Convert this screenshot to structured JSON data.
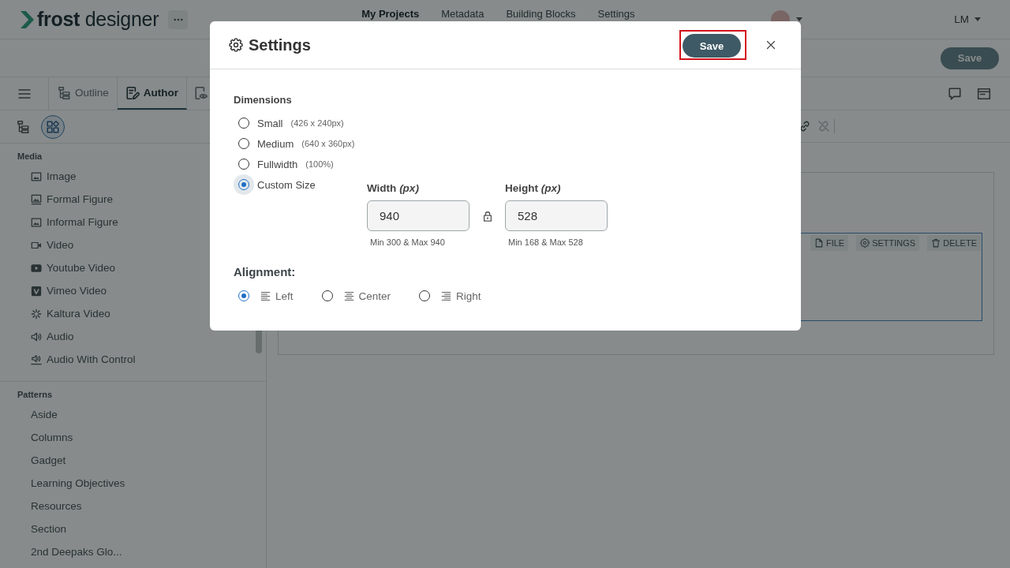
{
  "app_bar": {
    "logo": "**frost** designer",
    "nav": [
      {
        "label": "My Projects",
        "selected": true
      },
      {
        "label": "Metadata",
        "selected": false
      },
      {
        "label": "Building Blocks",
        "selected": false
      },
      {
        "label": "Settings",
        "selected": false
      }
    ],
    "user": "LM"
  },
  "action_bar": {
    "save_button": "Save"
  },
  "view_tabs": [
    {
      "label": "Outline",
      "selected": false
    },
    {
      "label": "Author",
      "selected": true
    },
    {
      "selected": false
    }
  ],
  "panel_views": [
    {
      "selected": false
    },
    {
      "selected": true
    }
  ],
  "sidebar": {
    "sections": [
      {
        "title": "Media",
        "kind": "icons",
        "items": [
          "Image",
          "Formal Figure",
          "Informal Figure",
          "Video",
          "Youtube Video",
          "Vimeo Video",
          "Kaltura Video",
          "Audio",
          "Audio With Control"
        ]
      },
      {
        "title": "Patterns",
        "kind": "plain",
        "items": [
          "Aside",
          "Columns",
          "Gadget",
          "Learning Objectives",
          "Resources",
          "Section",
          "2nd Deepaks Glo..."
        ]
      }
    ]
  },
  "editor": {
    "tools": [
      {
        "disabled": false
      },
      {
        "disabled": true
      }
    ],
    "block_actions": [
      "FILE",
      "SETTINGS",
      "DELETE"
    ]
  },
  "dialog": {
    "title": "Settings",
    "save_button": "Save",
    "save_highlighted": true,
    "dimensions": {
      "label": "Dimensions",
      "options": [
        {
          "label": "Small",
          "hint": "(426 x 240px)",
          "selected": false,
          "focused": false
        },
        {
          "label": "Medium",
          "hint": "(640 x 360px)",
          "selected": false,
          "focused": false
        },
        {
          "label": "Fullwidth",
          "hint": "(100%)",
          "selected": false,
          "focused": false
        },
        {
          "label": "Custom Size",
          "selected": true,
          "focused": true
        }
      ]
    },
    "custom_size": [
      {
        "label": "Width *(px)*",
        "value": "940",
        "hint": "Min 300 & Max 940"
      },
      {
        "label": "Height *(px)*",
        "value": "528",
        "hint": "Min 168 & Max 528"
      }
    ],
    "alignment": {
      "label": "Alignment:",
      "options": [
        {
          "label": "Left",
          "selected": true
        },
        {
          "label": "Center",
          "selected": false
        },
        {
          "label": "Right",
          "selected": false
        }
      ]
    }
  }
}
